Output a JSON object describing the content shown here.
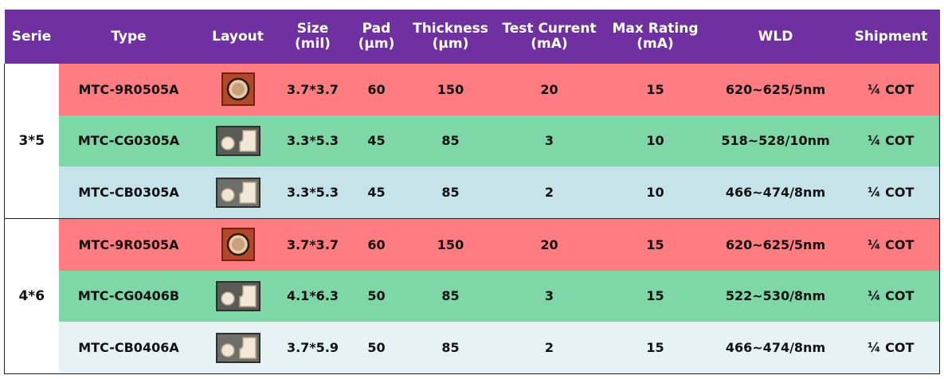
{
  "header": {
    "serie": "Serie",
    "type": "Type",
    "layout": "Layout",
    "size_l1": "Size",
    "size_l2": "(mil)",
    "pad_l1": "Pad",
    "pad_l2": "(µm)",
    "thickness_l1": "Thickness",
    "thickness_l2": "(µm)",
    "current_l1": "Test Current",
    "current_l2": "(mA)",
    "max_l1": "Max Rating",
    "max_l2": "(mA)",
    "wld": "WLD",
    "shipment": "Shipment"
  },
  "groups": [
    {
      "serie": "3*5",
      "rows": [
        {
          "type": "MTC-9R0505A",
          "layout": "red-round-chip",
          "size": "3.7*3.7",
          "pad": "60",
          "thickness": "150",
          "current": "20",
          "max": "15",
          "wld": "620~625/5nm",
          "shipment": "¼ COT",
          "color": "#FF7C80"
        },
        {
          "type": "MTC-CG0305A",
          "layout": "green-flip-chip",
          "size": "3.3*5.3",
          "pad": "45",
          "thickness": "85",
          "current": "3",
          "max": "10",
          "wld": "518~528/10nm",
          "shipment": "¼ COT",
          "color": "#7FD7A8"
        },
        {
          "type": "MTC-CB0305A",
          "layout": "blue-flip-chip",
          "size": "3.3*5.3",
          "pad": "45",
          "thickness": "85",
          "current": "2",
          "max": "10",
          "wld": "466~474/8nm",
          "shipment": "¼ COT",
          "color": "#C5E3E8"
        }
      ]
    },
    {
      "serie": "4*6",
      "rows": [
        {
          "type": "MTC-9R0505A",
          "layout": "red-round-chip",
          "size": "3.7*3.7",
          "pad": "60",
          "thickness": "150",
          "current": "20",
          "max": "15",
          "wld": "620~625/5nm",
          "shipment": "¼ COT",
          "color": "#FF7C80"
        },
        {
          "type": "MTC-CG0406B",
          "layout": "green-flip-chip",
          "size": "4.1*6.3",
          "pad": "50",
          "thickness": "85",
          "current": "3",
          "max": "15",
          "wld": "522~530/8nm",
          "shipment": "¼ COT",
          "color": "#7FD7A8"
        },
        {
          "type": "MTC-CB0406A",
          "layout": "blue-flip-chip",
          "size": "3.7*5.9",
          "pad": "50",
          "thickness": "85",
          "current": "2",
          "max": "15",
          "wld": "466~474/8nm",
          "shipment": "¼ COT",
          "color": "#E6F2F5"
        }
      ]
    }
  ],
  "colors": {
    "header_bg": "#7031A0",
    "header_text": "#FFFFFF"
  }
}
